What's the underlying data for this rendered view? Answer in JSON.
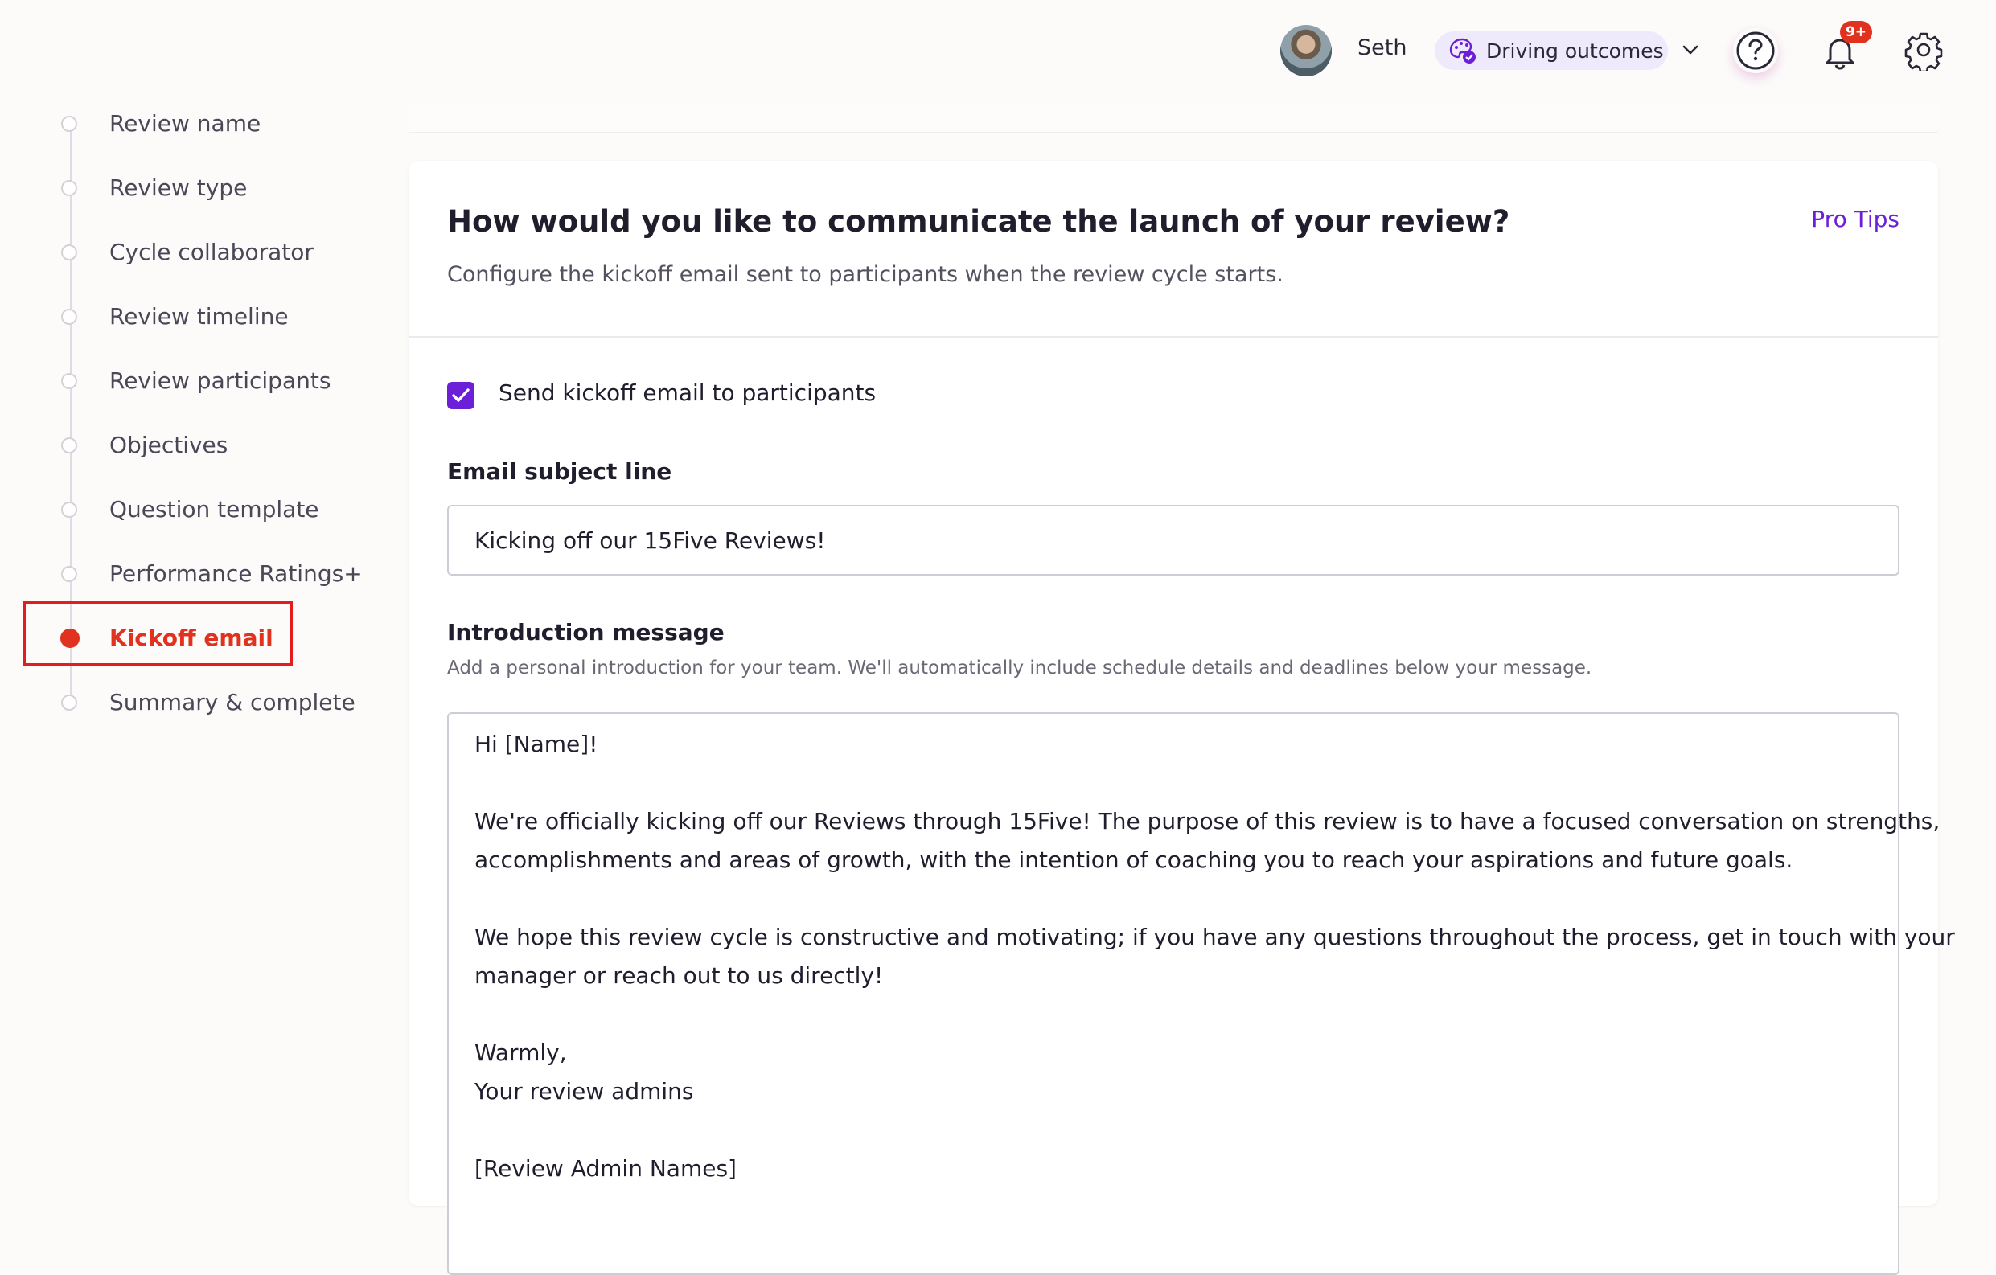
{
  "header": {
    "user_name": "Seth",
    "org_name": "Driving outcomes",
    "notification_badge": "9+",
    "icons": [
      "avatar",
      "palette-icon",
      "chevron-down-icon",
      "help-icon",
      "bell-icon",
      "gear-icon"
    ]
  },
  "sidebar": {
    "steps": [
      {
        "label": "Review name",
        "state": "incomplete"
      },
      {
        "label": "Review type",
        "state": "incomplete"
      },
      {
        "label": "Cycle collaborator",
        "state": "incomplete"
      },
      {
        "label": "Review timeline",
        "state": "incomplete"
      },
      {
        "label": "Review participants",
        "state": "incomplete"
      },
      {
        "label": "Objectives",
        "state": "incomplete"
      },
      {
        "label": "Question template",
        "state": "incomplete"
      },
      {
        "label": "Performance Ratings+",
        "state": "incomplete"
      },
      {
        "label": "Kickoff email",
        "state": "active"
      },
      {
        "label": "Summary & complete",
        "state": "incomplete"
      }
    ]
  },
  "main": {
    "title": "How would you like to communicate the launch of your review?",
    "subtitle": "Configure the kickoff email sent to participants when the review cycle starts.",
    "pro_tips": "Pro Tips",
    "send_checkbox": {
      "label": "Send kickoff email to participants",
      "checked": true
    },
    "subject": {
      "label": "Email subject line",
      "value": "Kicking off our 15Five Reviews!"
    },
    "intro": {
      "label": "Introduction message",
      "help": "Add a personal introduction for your team. We'll automatically include schedule details and deadlines below your message.",
      "lines": [
        "Hi [Name]!",
        "",
        "We're officially kicking off our Reviews through 15Five! The purpose of this review is to have a focused conversation on strengths,",
        "accomplishments and areas of growth, with the intention of coaching you to reach your aspirations and future goals.",
        "",
        "We hope this review cycle is constructive and motivating; if you have any questions throughout the process, get in touch with your",
        "manager or reach out to us directly!",
        "",
        "Warmly,",
        "Your review admins",
        "",
        "[Review Admin Names]"
      ]
    }
  },
  "colors": {
    "accent": "#6b1fd6",
    "active_step": "#e0321f",
    "highlight_box": "#e11d1d"
  }
}
